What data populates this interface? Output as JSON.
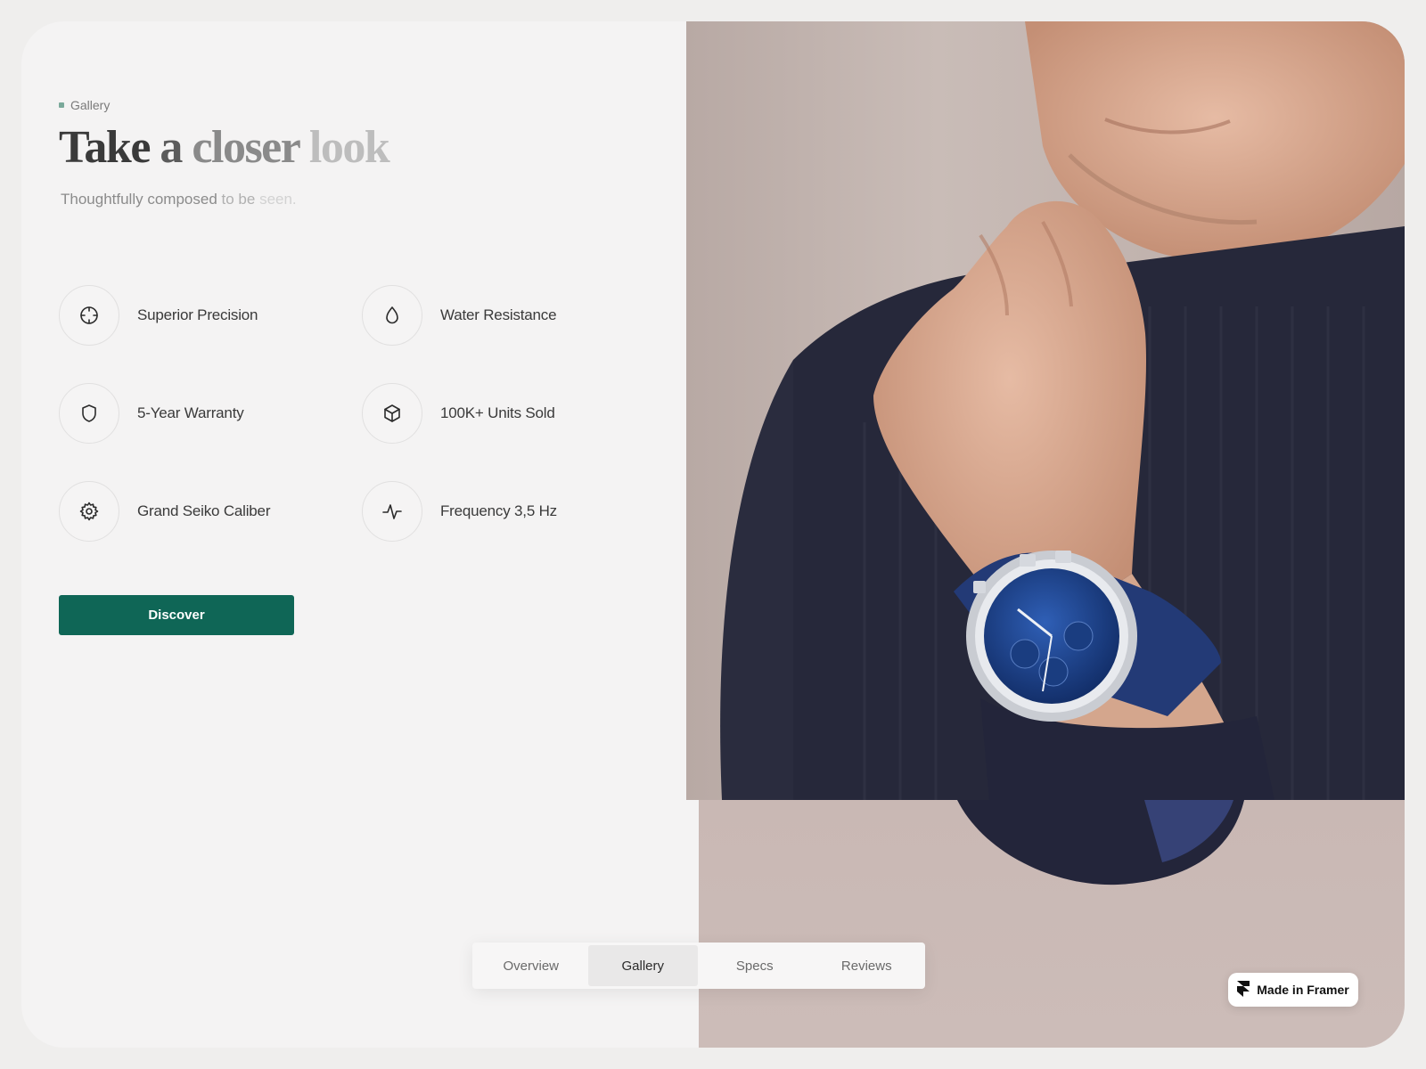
{
  "section": {
    "eyebrow": "Gallery",
    "title_words": [
      "Take",
      "a",
      "closer",
      "look"
    ],
    "subtitle_parts": [
      "Thoughtfully composed",
      "to be",
      "seen."
    ]
  },
  "features": [
    {
      "label": "Superior Precision",
      "icon": "crosshair-icon"
    },
    {
      "label": "Water Resistance",
      "icon": "droplet-icon"
    },
    {
      "label": "5-Year Warranty",
      "icon": "shield-icon"
    },
    {
      "label": "100K+ Units Sold",
      "icon": "box-icon"
    },
    {
      "label": "Grand Seiko Caliber",
      "icon": "gear-icon"
    },
    {
      "label": "Frequency 3,5 Hz",
      "icon": "pulse-icon"
    }
  ],
  "cta": {
    "label": "Discover"
  },
  "tabs": [
    {
      "label": "Overview",
      "active": false
    },
    {
      "label": "Gallery",
      "active": true
    },
    {
      "label": "Specs",
      "active": false
    },
    {
      "label": "Reviews",
      "active": false
    }
  ],
  "badge": {
    "label": "Made in Framer",
    "icon": "framer-icon"
  },
  "colors": {
    "accent": "#0f6656",
    "eyebrow_dot": "#7aa99a",
    "page_bg": "#efeeed",
    "card_bg": "#f4f3f3"
  }
}
